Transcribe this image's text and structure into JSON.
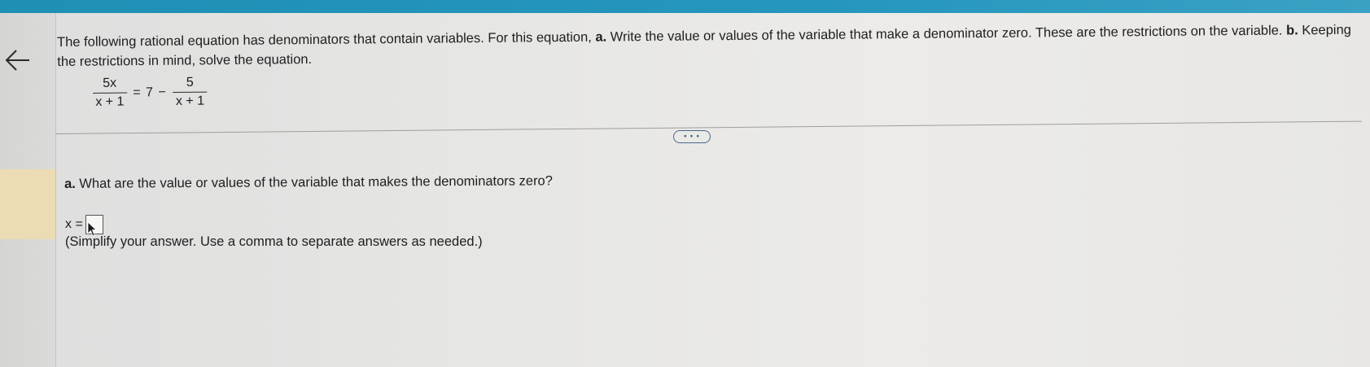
{
  "question": {
    "text_1": "The following rational equation has denominators that contain variables. For this equation, ",
    "part_a_marker": "a.",
    "text_2": " Write the value or values of the variable that make a denominator zero. These are the restrictions on the variable. ",
    "part_b_marker": "b.",
    "text_3": " Keeping the restrictions in mind, solve the equation."
  },
  "equation": {
    "lhs_numerator": "5x",
    "lhs_denominator": "x + 1",
    "middle": "= 7 −",
    "rhs_numerator": "5",
    "rhs_denominator": "x + 1"
  },
  "expand_button": {
    "label": "• • •"
  },
  "part_a": {
    "marker": "a.",
    "prompt": " What are the value or values of the variable that makes the denominators zero?"
  },
  "answer": {
    "label": "x =",
    "value": ""
  },
  "hint": "(Simplify your answer. Use a comma to separate answers as needed.)",
  "icons": {
    "back": "arrow-left-icon",
    "pointer": "mouse-pointer-icon"
  },
  "colors": {
    "top_bar": "#2596bd",
    "active_marker": "#ecdcb3",
    "button_border": "#4a6a8c"
  }
}
